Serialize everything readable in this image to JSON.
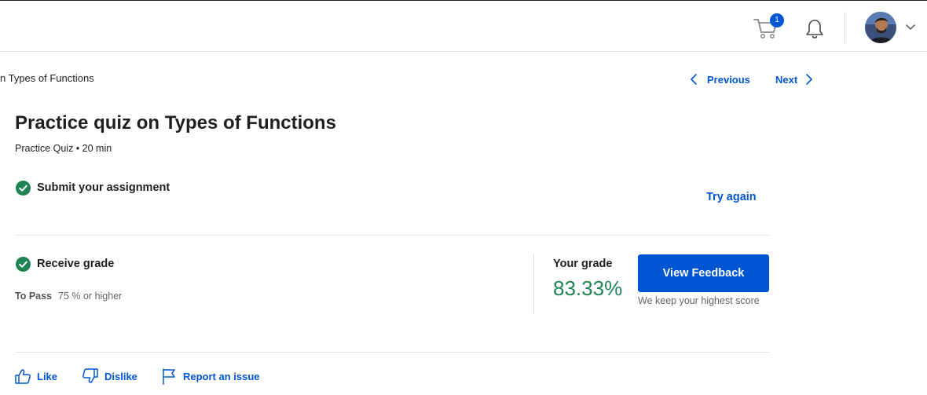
{
  "header": {
    "cart_badge_count": "1",
    "icons": [
      "shopping-cart-icon",
      "bell-icon",
      "chevron-down-icon"
    ]
  },
  "breadcrumb": {
    "text": "n Types of Functions"
  },
  "nav": {
    "previous_label": "Previous",
    "next_label": "Next"
  },
  "quiz": {
    "title": "Practice quiz on Types of Functions",
    "subtitle": "Practice Quiz • 20 min"
  },
  "submit_step": {
    "label": "Submit your assignment",
    "action_label": "Try again",
    "status_icon": "check-circle-icon"
  },
  "grade_step": {
    "label": "Receive grade",
    "to_pass_label": "To Pass",
    "to_pass_value": "75 % or higher",
    "your_grade_label": "Your grade",
    "grade_value": "83.33%",
    "feedback_button_label": "View Feedback",
    "keep_note": "We keep your highest score",
    "status_icon": "check-circle-icon"
  },
  "footer_actions": {
    "like_label": "Like",
    "dislike_label": "Dislike",
    "report_label": "Report an issue"
  },
  "colors": {
    "accent": "#0056d2",
    "success": "#1f8354",
    "text": "#1f1f1f",
    "muted": "#636363",
    "divider": "#e1e1e1"
  }
}
